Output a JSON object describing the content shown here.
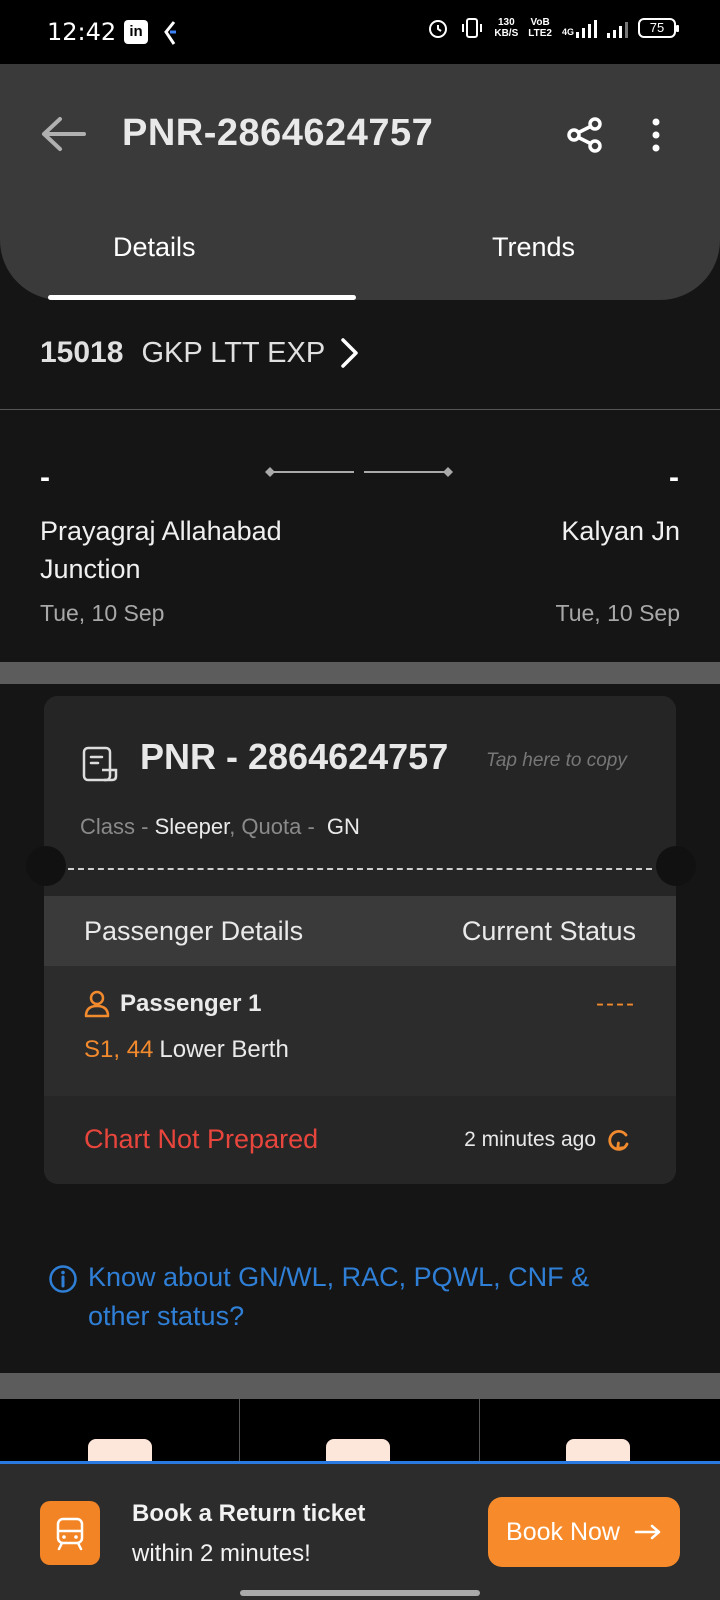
{
  "status_bar": {
    "time": "12:42",
    "app_icons": [
      "linkedin-icon",
      "k-app-icon"
    ],
    "net_speed_value": "130",
    "net_speed_unit": "KB/S",
    "volte_top": "VoB",
    "volte_bottom": "LTE2",
    "network": "4G",
    "battery": "75"
  },
  "header": {
    "title": "PNR-2864624757",
    "tabs": [
      {
        "label": "Details",
        "active": true
      },
      {
        "label": "Trends",
        "active": false
      }
    ]
  },
  "train": {
    "number": "15018",
    "name": "GKP LTT EXP"
  },
  "journey": {
    "from": {
      "time": "-",
      "station": "Prayagraj Allahabad Junction",
      "date": "Tue, 10 Sep"
    },
    "to": {
      "time": "-",
      "station": "Kalyan Jn",
      "date": "Tue, 10 Sep"
    }
  },
  "ticket": {
    "pnr_label": "PNR - 2864624757",
    "copy_hint": "Tap here to copy",
    "class_label": "Class - ",
    "class_value": "Sleeper",
    "quota_label": ", Quota - ",
    "quota_value": "GN",
    "table_headers": {
      "passenger": "Passenger Details",
      "status": "Current Status"
    },
    "passengers": [
      {
        "name": "Passenger 1",
        "coach_seat": "S1, 44",
        "berth": "Lower Berth",
        "status": "----"
      }
    ],
    "chart_status": "Chart Not Prepared",
    "last_updated": "2 minutes ago"
  },
  "info_link": "Know about GN/WL, RAC, PQWL, CNF & other status?",
  "banner": {
    "line1": "Book a Return ticket",
    "line2": "within 2 minutes!",
    "button": "Book Now"
  },
  "colors": {
    "accent_orange": "#f78b2b",
    "error_red": "#e8453c",
    "link_blue": "#2f7fd6",
    "header_bg": "#3a3a3a"
  }
}
